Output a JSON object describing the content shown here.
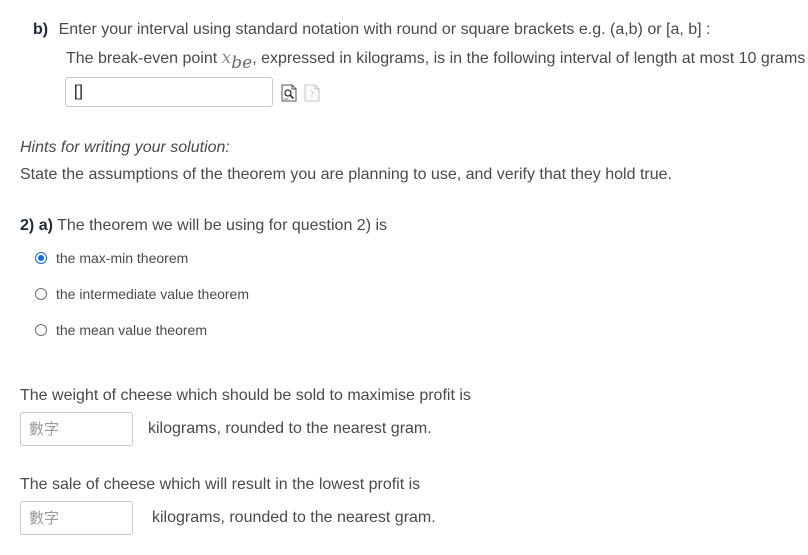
{
  "part_b": {
    "label": "b)",
    "instruction": "Enter your interval using standard notation with round or square brackets e.g. (a,b) or [a, b] :",
    "sentence_before": "The break-even point ",
    "math_var": "x",
    "math_sub": "be",
    "sentence_after": ", expressed in kilograms, is in the following interval of length at most 10 grams",
    "input_value": "[]"
  },
  "hints": {
    "title": "Hints for writing your solution:",
    "body": "State the assumptions of the theorem you are planning to use, and verify that they hold true."
  },
  "question_2a": {
    "number": "2)",
    "part": "a)",
    "text": "The theorem we will be using for question 2) is",
    "options": [
      {
        "label": "the max-min theorem",
        "checked": true
      },
      {
        "label": "the intermediate value theorem",
        "checked": false
      },
      {
        "label": "the mean value theorem",
        "checked": false
      }
    ]
  },
  "maximise": {
    "text": "The weight of cheese which should be sold to maximise profit is",
    "placeholder": "數字",
    "unit": "kilograms, rounded to the nearest gram."
  },
  "lowest": {
    "text": "The sale of cheese which will result in the lowest profit  is",
    "placeholder": "數字",
    "unit": "kilograms, rounded to the nearest gram."
  },
  "icons": {
    "preview": "preview-icon",
    "help": "help-icon"
  },
  "colors": {
    "radio_accent": "#0b6ee8"
  }
}
